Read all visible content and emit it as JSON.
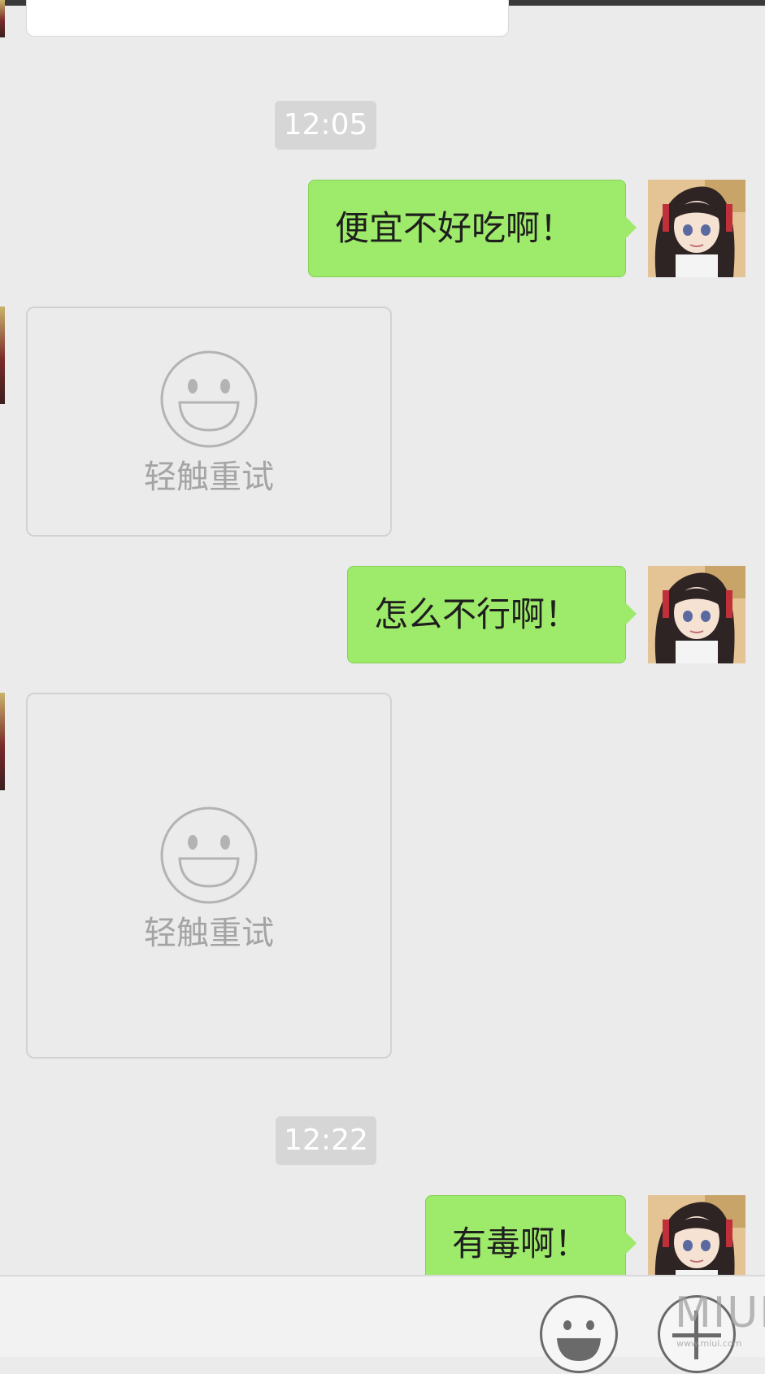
{
  "conversation": {
    "timestamps": [
      "12:05",
      "12:22"
    ],
    "outgoing_messages": [
      "便宜不好吃啊！",
      "怎么不行啊！",
      "有毒啊！"
    ],
    "image_placeholders": [
      {
        "label": "轻触重试"
      },
      {
        "label": "轻触重试"
      }
    ]
  },
  "input_bar": {
    "emoji_button_icon": "smiley-icon",
    "more_button_icon": "plus-icon"
  },
  "watermark": {
    "logo_text": "MIUI",
    "site_text": "www.miui.com"
  },
  "colors": {
    "chat_background": "#ebebeb",
    "outgoing_bubble": "#9eea6a",
    "timestamp_pill": "#d6d6d6",
    "placeholder_icon": "#b3b3b3"
  }
}
